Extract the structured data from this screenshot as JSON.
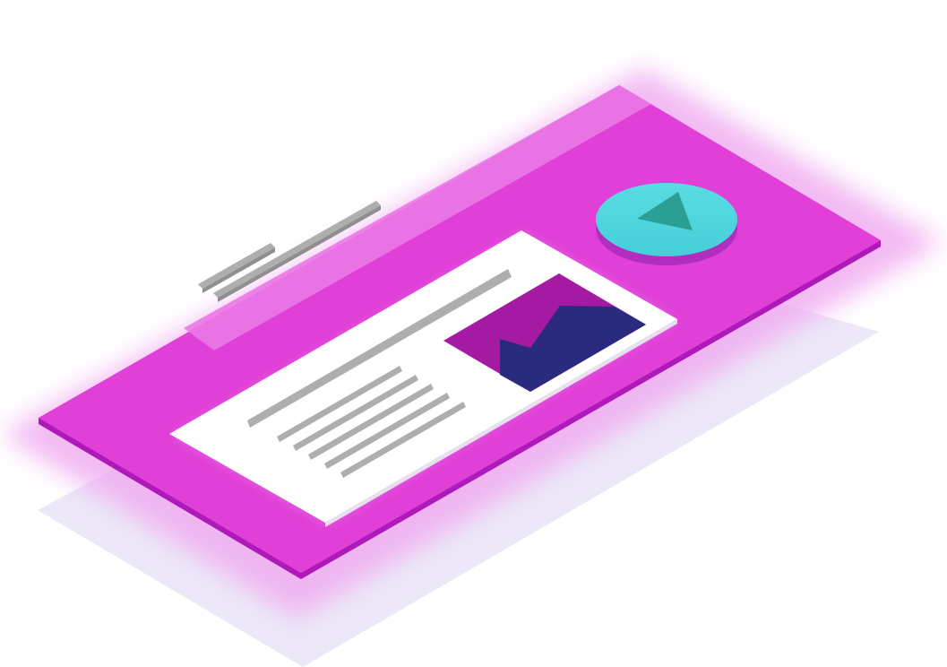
{
  "illustration": {
    "kind": "isometric-web-page-mockup",
    "colors": {
      "background": "#ffffff",
      "shadow": "#ece8f8",
      "panel_glow": "#f0a9f0",
      "panel_top": "#e03fd8",
      "panel_edge": "#b019b9",
      "panel_highlight": "#ea78e6",
      "card_white": "#ffffff",
      "card_edge": "#e7e1ef",
      "text_line": "#aeaeae",
      "text_line_edge": "#8f8f8f",
      "image_bg": "#a41aa3",
      "image_mountain": "#2a2b7f",
      "play_button_face": "#55d7de",
      "play_button_side": "#b12dc0",
      "play_icon": "#2c9f95"
    },
    "icons": [
      "play-icon",
      "image-icon"
    ],
    "elements": [
      "floating-text-lines",
      "browser-panel",
      "content-card",
      "play-button"
    ]
  }
}
